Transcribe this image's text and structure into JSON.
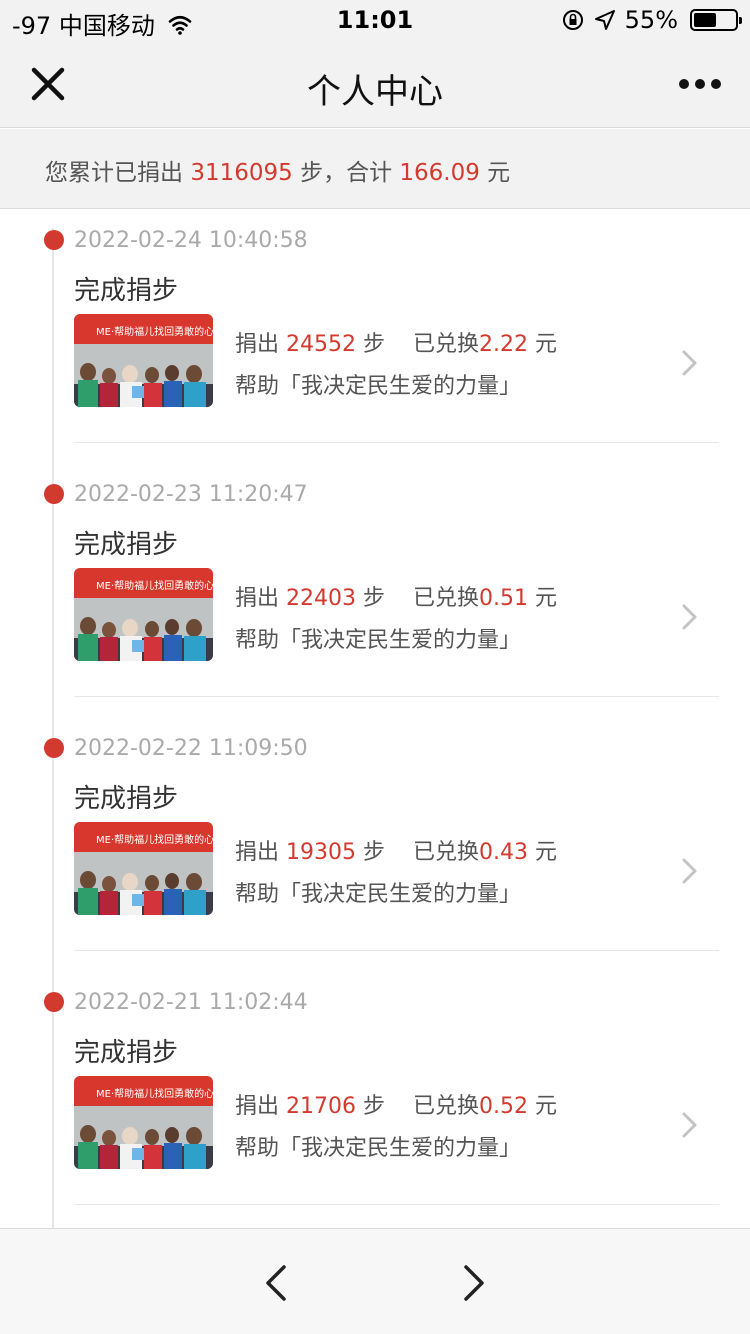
{
  "status_bar": {
    "signal": "-97",
    "carrier": "中国移动",
    "time": "11:01",
    "battery_text": "55%",
    "battery_level": 0.55
  },
  "nav": {
    "title": "个人中心",
    "close_icon": "close-icon",
    "more_icon": "more-icon"
  },
  "summary": {
    "prefix": "您累计已捐出",
    "steps": "3116095",
    "mid": "步，合计",
    "amount": "166.09",
    "unit": "元"
  },
  "labels": {
    "donate_prefix": "捐出",
    "steps_unit": "步",
    "exchanged": "已兑换",
    "yuan": "元",
    "help_prefix": "帮助「",
    "help_suffix": "」"
  },
  "records": [
    {
      "time": "2022-02-24 10:40:58",
      "title": "完成捐步",
      "steps": "24552",
      "amount": "2.22",
      "project": "我决定民生爱的力量",
      "thumb_text": "ME·帮助福儿找回勇敢的心"
    },
    {
      "time": "2022-02-23 11:20:47",
      "title": "完成捐步",
      "steps": "22403",
      "amount": "0.51",
      "project": "我决定民生爱的力量",
      "thumb_text": "ME·帮助福儿找回勇敢的心"
    },
    {
      "time": "2022-02-22 11:09:50",
      "title": "完成捐步",
      "steps": "19305",
      "amount": "0.43",
      "project": "我决定民生爱的力量",
      "thumb_text": "ME·帮助福儿找回勇敢的心"
    },
    {
      "time": "2022-02-21 11:02:44",
      "title": "完成捐步",
      "steps": "21706",
      "amount": "0.52",
      "project": "我决定民生爱的力量",
      "thumb_text": "ME·帮助福儿找回勇敢的心"
    }
  ],
  "colors": {
    "accent": "#d33a2f",
    "bar_bg": "#f2f2f2"
  }
}
